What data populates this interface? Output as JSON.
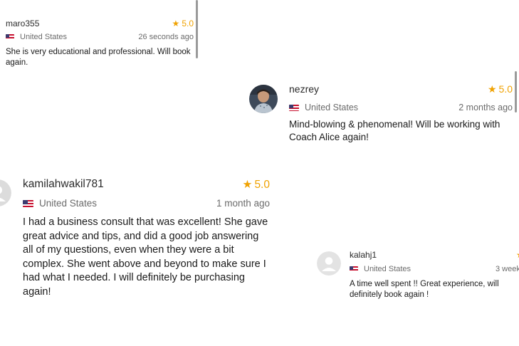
{
  "reviews": [
    {
      "username": "maro355",
      "rating": "5.0",
      "country": "United States",
      "time_ago": "26 seconds ago",
      "text": "She is very educational and professional. Will book again."
    },
    {
      "username": "nezrey",
      "rating": "5.0",
      "country": "United States",
      "time_ago": "2 months ago",
      "text": "Mind-blowing & phenomenal! Will be working with Coach Alice again!"
    },
    {
      "username": "kamilahwakil781",
      "rating": "5.0",
      "country": "United States",
      "time_ago": "1 month ago",
      "text": "I had a business consult that was excellent! She gave great advice and tips, and did a good job answering all of my questions, even when they were a bit complex. She went above and beyond to make sure I had what I needed. I will definitely be purchasing again!"
    },
    {
      "username": "kalahj1",
      "rating": "",
      "country": "United States",
      "time_ago": "3 week",
      "text": "A time well spent !! Great experience, will definitely book again !"
    }
  ],
  "colors": {
    "star": "#f0a202",
    "muted_text": "#6b6b6b",
    "scrollbar": "#9a9a9a"
  },
  "icons": {
    "rating": "star-icon",
    "country": "us-flag-icon",
    "avatar_placeholder": "user-placeholder-icon"
  }
}
